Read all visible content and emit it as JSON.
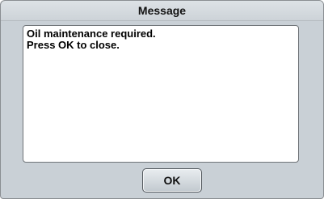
{
  "dialog": {
    "title": "Message",
    "message_lines": [
      "Oil maintenance required.",
      "Press OK to close."
    ],
    "ok_label": "OK"
  }
}
